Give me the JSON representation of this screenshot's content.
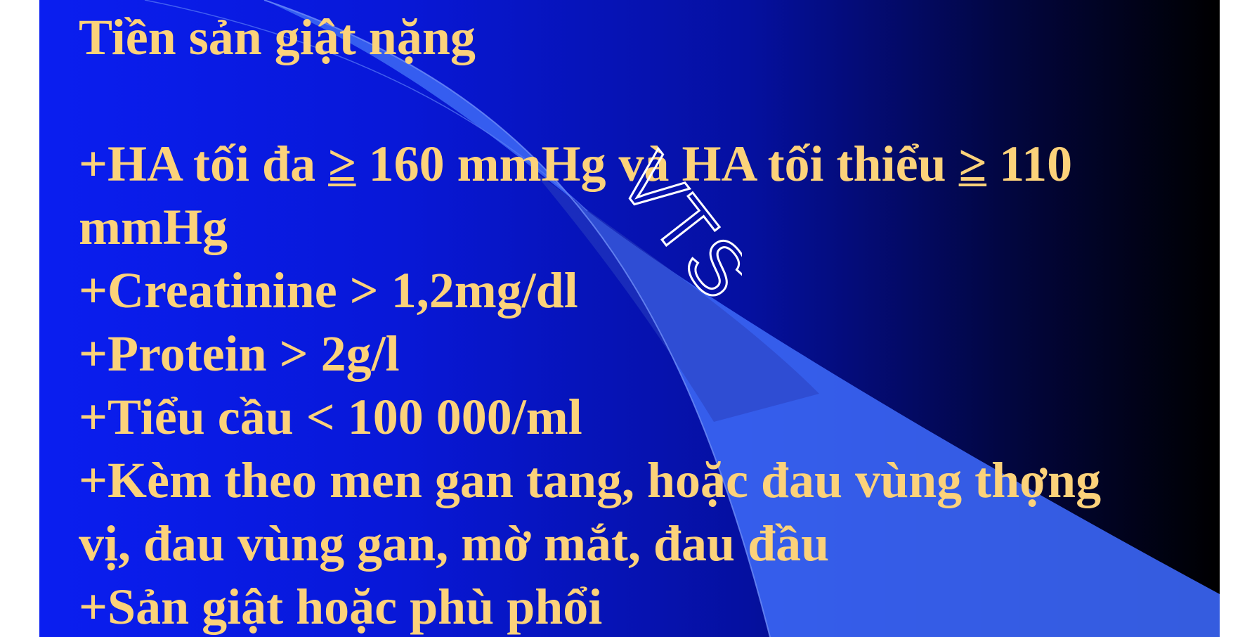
{
  "slide": {
    "title": "Tiền sản giật nặng",
    "items": {
      "ha": {
        "prefix": "+HA tối đa ",
        "sym1": "≥",
        "mid": " 160 mmHg và HA tối thiểu ",
        "sym2": "≥",
        "suffix": " 110",
        "cont": "mmHg"
      },
      "creatinine": "+Creatinine > 1,2mg/dl",
      "protein": "+Protein > 2g/l",
      "platelets": "+Tiểu cầu < 100 000/ml",
      "symptoms_1": "+Kèm theo men gan tang, hoặc đau vùng thợng",
      "symptoms_2": "vị, đau vùng gan, mờ mắt, đau đầu",
      "eclampsia": "+Sản giật hoặc phù phổi"
    },
    "watermark": "VTS"
  },
  "colors": {
    "text": "#fcd27a",
    "background_left": "#0a1ef0",
    "background_right": "#000000",
    "swoosh": "#3a64f2"
  }
}
